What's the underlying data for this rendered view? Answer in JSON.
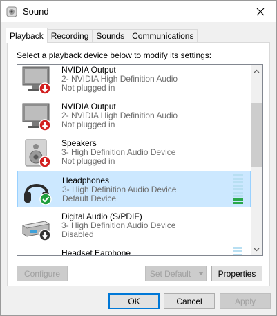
{
  "window": {
    "title": "Sound"
  },
  "tabs": [
    {
      "label": "Playback",
      "active": true
    },
    {
      "label": "Recording",
      "active": false
    },
    {
      "label": "Sounds",
      "active": false
    },
    {
      "label": "Communications",
      "active": false
    }
  ],
  "instruction": "Select a playback device below to modify its settings:",
  "devices": [
    {
      "name": "NVIDIA Output",
      "driver": "2- NVIDIA High Definition Audio",
      "status": "Not plugged in",
      "icon": "monitor-icon",
      "badge": "unplugged-badge-icon"
    },
    {
      "name": "NVIDIA Output",
      "driver": "2- NVIDIA High Definition Audio",
      "status": "Not plugged in",
      "icon": "monitor-icon",
      "badge": "unplugged-badge-icon"
    },
    {
      "name": "Speakers",
      "driver": "3- High Definition Audio Device",
      "status": "Not plugged in",
      "icon": "speaker-icon",
      "badge": "unplugged-badge-icon"
    },
    {
      "name": "Headphones",
      "driver": "3- High Definition Audio Device",
      "status": "Default Device",
      "icon": "headphones-icon",
      "badge": "default-check-icon",
      "selected": true
    },
    {
      "name": "Digital Audio (S/PDIF)",
      "driver": "3- High Definition Audio Device",
      "status": "Disabled",
      "icon": "digital-audio-icon",
      "badge": "disabled-badge-icon"
    },
    {
      "name": "Headset Earphone",
      "driver": "",
      "status": "",
      "icon": "headset-icon",
      "badge": ""
    }
  ],
  "buttons": {
    "configure": "Configure",
    "set_default": "Set Default",
    "properties": "Properties",
    "ok": "OK",
    "cancel": "Cancel",
    "apply": "Apply"
  },
  "colors": {
    "selection_bg": "#cce8ff",
    "selection_border": "#99d1ff",
    "default_check": "#1e9e3c",
    "unplugged_badge": "#d21f1f",
    "meter": "#2aa84a"
  }
}
